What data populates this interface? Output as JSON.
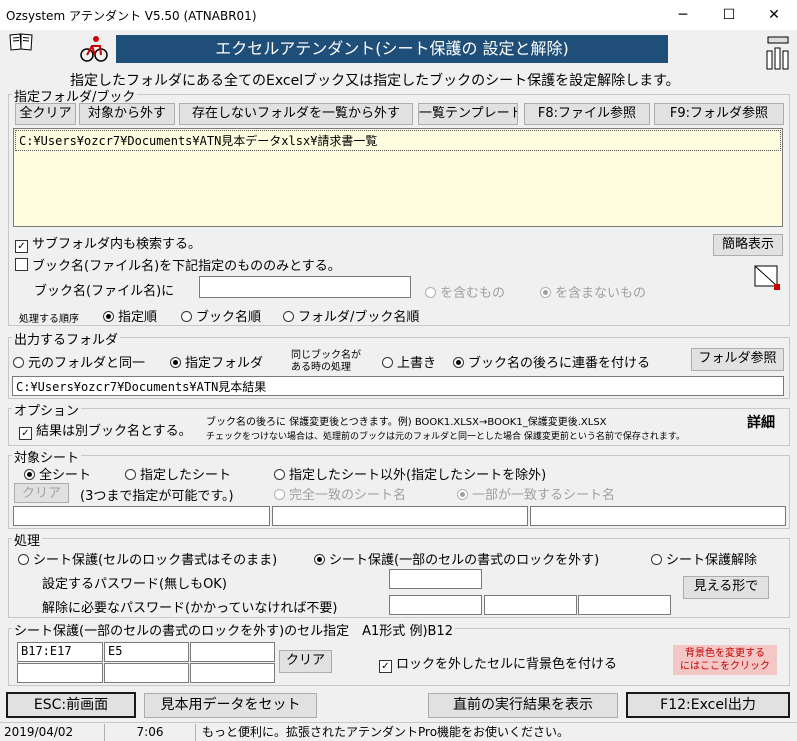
{
  "window": {
    "title": "Ozsystem アテンダント V5.50 (ATNABR01)"
  },
  "header": {
    "banner": "エクセルアテンダント(シート保護の 設定と解除)",
    "description": "指定したフォルダにある全てのExcelブック又は指定したブックのシート保護を設定解除します。"
  },
  "folder_group": {
    "label": "指定フォルダ/ブック",
    "buttons": {
      "clear_all": "全クリア",
      "exclude": "対象から外す",
      "remove_missing": "存在しないフォルダを一覧から外す",
      "list_template": "一覧テンプレート",
      "f8_file": "F8:ファイル参照",
      "f9_folder": "F9:フォルダ参照"
    },
    "paths": [
      "C:¥Users¥ozcr7¥Documents¥ATN見本データxlsx¥請求書一覧"
    ],
    "subfolder_label": "サブフォルダ内も検索する。",
    "subfolder_checked": true,
    "book_filter_label": "ブック名(ファイル名)を下記指定のもののみとする。",
    "book_filter_checked": false,
    "brief_button": "簡略表示",
    "book_name_prefix": "ブック名(ファイル名)に",
    "book_name_value": "",
    "contains_label": "を含むもの",
    "not_contains_label": "を含まないもの",
    "order_label": "処理する順序",
    "order_options": [
      "指定順",
      "ブック名順",
      "フォルダ/ブック名順"
    ]
  },
  "output_group": {
    "label": "出力するフォルダ",
    "same_folder": "元のフォルダと同一",
    "specified_folder": "指定フォルダ",
    "same_name_note_1": "同じブック名が",
    "same_name_note_2": "ある時の処理",
    "overwrite": "上書き",
    "serial": "ブック名の後ろに連番を付ける",
    "folder_ref_button": "フォルダ参照",
    "output_path": "C:¥Users¥ozcr7¥Documents¥ATN見本結果"
  },
  "options_group": {
    "label": "オプション",
    "separate_book_label": "結果は別ブック名とする。",
    "separate_book_checked": true,
    "note_1": "ブック名の後ろに 保護変更後とつきます。例) BOOK1.XLSX→BOOK1_保護変更後.XLSX",
    "note_2": "チェックをつけない場合は、処理前のブックは元のフォルダと同一とした場合 保護変更前という名前で保存されます。",
    "details_label": "詳細"
  },
  "sheet_group": {
    "label": "対象シート",
    "all_sheets": "全シート",
    "specified_sheets": "指定したシート",
    "except_sheets": "指定したシート以外(指定したシートを除外)",
    "clear_button": "クリア",
    "limit_note": "(3つまで指定が可能です。)",
    "exact_match": "完全一致のシート名",
    "partial_match": "一部が一致するシート名",
    "sheet_names": [
      "",
      "",
      ""
    ]
  },
  "process_group": {
    "label": "処理",
    "protect_keep": "シート保護(セルのロック書式はそのまま)",
    "protect_unlock": "シート保護(一部のセルの書式のロックを外す)",
    "unprotect": "シート保護解除",
    "set_password_label": "設定するパスワード(無しもOK)",
    "set_password": "",
    "unlock_password_label": "解除に必要なパスワード(かかっていなければ不要)",
    "unlock_passwords": [
      "",
      "",
      ""
    ],
    "show_button": "見える形で"
  },
  "cells_group": {
    "label": "シート保護(一部のセルの書式のロックを外す)のセル指定　A1形式 例)B12",
    "cells": [
      "B17:E17",
      "E5",
      "",
      "",
      "",
      ""
    ],
    "clear_button": "クリア",
    "bg_color_label": "ロックを外したセルに背景色を付ける",
    "bg_color_checked": true,
    "bg_hint_1": "背景色を変更する",
    "bg_hint_2": "にはここをクリック",
    "bg_hint_color": "#f4c7c7",
    "bg_hint_text_color": "#c00000"
  },
  "footer": {
    "esc_button": "ESC:前画面",
    "sample_button": "見本用データをセット",
    "last_result_button": "直前の実行結果を表示",
    "f12_button": "F12:Excel出力"
  },
  "status_bar": {
    "date": "2019/04/02",
    "time": "7:06",
    "message": "もっと便利に。拡張されたアテンダントPro機能をお使いください。"
  },
  "colors": {
    "banner_bg": "#1f4f79",
    "banner_text": "#ffffff",
    "list_bg": "#fffde0"
  }
}
